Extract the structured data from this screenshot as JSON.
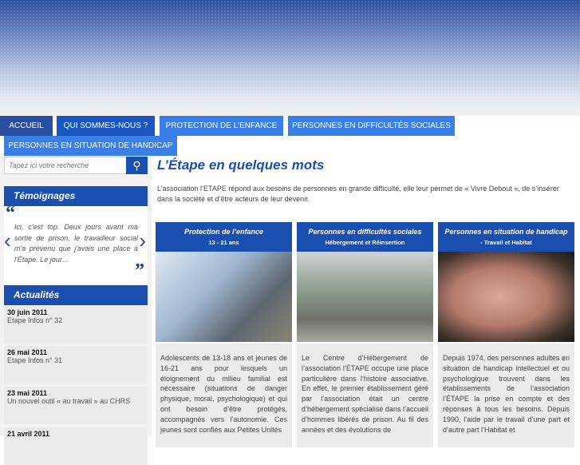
{
  "nav": {
    "items": [
      "ACCUEIL",
      "QUI SOMMES-NOUS ?",
      "PROTECTION DE L'ENFANCE",
      "PERSONNES EN DIFFICULTÉS SOCIALES",
      "PERSONNES EN SITUATION DE HANDICAP"
    ]
  },
  "search": {
    "placeholder": "Tapez ici votre recherche"
  },
  "testimonials": {
    "title": "Témoignages",
    "quote": "Ici, c'est top. Deux jours avant ma sortie de prison, le travailleur social m'a prévenu que j'avais une place à l'Étape. Le jour…",
    "open_quote": "“",
    "close_quote": "”",
    "prev": "‹",
    "next": "›"
  },
  "news": {
    "title": "Actualités",
    "items": [
      {
        "date": "30 juin 2011",
        "text": "Etape Infos n° 32"
      },
      {
        "date": "26 mai 2011",
        "text": "Etape Infos n° 31"
      },
      {
        "date": "23 mai 2011",
        "text": "Un nouvel outil « au travail » au CHRS"
      },
      {
        "date": "21 avril 2011",
        "text": ""
      }
    ]
  },
  "main": {
    "title": "L’Étape en quelques mots",
    "intro": "L’association l’ETAPE répond aux besoins de personnes en grande difficulté, elle leur permet de « Vivre Debout », de s’insérer dans la société et d’être acteurs de leur devenir.",
    "cards": [
      {
        "title": "Protection de l’enfance",
        "subtitle": "13 - 21 ans",
        "text": "Adolescents de 13-18 ans et jeunes de 16-21 ans pour lesquels un éloignement du milieu familial est nécessaire (situations de danger physique, moral, psychologique) et qui ont besoin d’être protégés, accompagnés vers l’autonomie. Ces jeunes sont confiés aux Petites Unités"
      },
      {
        "title": "Personnes en difficultés sociales",
        "subtitle": "Hébergement et Réinsertion",
        "text": "Le Centre d’Hébergement de l’association l’ÉTAPE occupe une place particulière dans l’histoire associative. En effet, le premier établissement géré par l’association était un centre d’hébergement spécialisé dans l’accueil d’hommes libérés de prison. Au fil des années et des évolutions de"
      },
      {
        "title": "Personnes en situation de handicap",
        "subtitle": "- Travail et Habitat",
        "text": "Depuis 1974, des personnes adultes en situation de handicap intellectuel et ou psychologique trouvent dans les établissements de l’association l’ÉTAPE la prise en compte et des réponses à tous les besoins. Depuis 1990, l’aide par le travail d’une part et d’autre part l’Habitat et"
      }
    ]
  }
}
